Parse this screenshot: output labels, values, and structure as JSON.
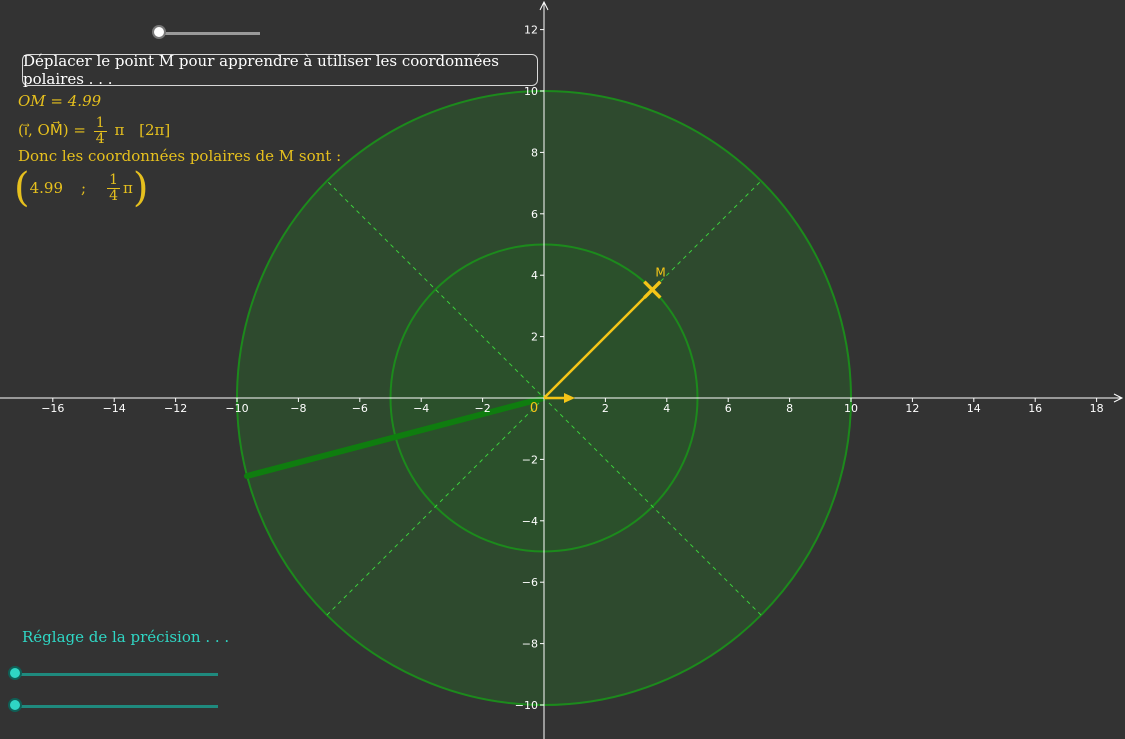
{
  "top_slider": {
    "value_fraction": 0.0,
    "track_color": "#9a9a9a",
    "knob_color": "#ffffff"
  },
  "info_box": {
    "text": "Déplacer le point M pour apprendre à utiliser les coordonnées polaires . . ."
  },
  "readout": {
    "om_label": "OM = 4.99",
    "angle_prefix": "(i⃗, OM⃗) =",
    "angle_num": "1",
    "angle_den": "4",
    "angle_pi": "π",
    "angle_mod": "[2π]",
    "conclusion": "Donc les coordonnées polaires de M sont  :",
    "coord_r": "4.99",
    "coord_sep": ";",
    "coord_num": "1",
    "coord_den": "4",
    "coord_pi": "π"
  },
  "precision": {
    "label": "Réglage de la précision . . .",
    "sliders": [
      {
        "name": "precision-slider-1",
        "value_fraction": 0.0
      },
      {
        "name": "precision-slider-2",
        "value_fraction": 0.0
      }
    ],
    "color": "#2fd6c4"
  },
  "graph": {
    "origin_label": "0",
    "point_label": "M",
    "point_r": 4.99,
    "point_angle_over_pi": 0.25,
    "outer_radius": 10,
    "inner_radius": 5,
    "x_ticks": [
      -16,
      -14,
      -12,
      -10,
      -8,
      -6,
      -4,
      -2,
      2,
      4,
      6,
      8,
      10,
      12,
      14,
      16,
      18
    ],
    "y_ticks": [
      12,
      10,
      8,
      6,
      4,
      2,
      -2,
      -4,
      -6,
      -8,
      -10
    ],
    "colors": {
      "disk_fill": "#2e4a2e",
      "circle_stroke": "#1c8a1c",
      "dashed_line": "#3ccf3c",
      "vector": "#f5c518",
      "axis": "#ffffff",
      "thick_ray": "#0f7d0f"
    }
  }
}
